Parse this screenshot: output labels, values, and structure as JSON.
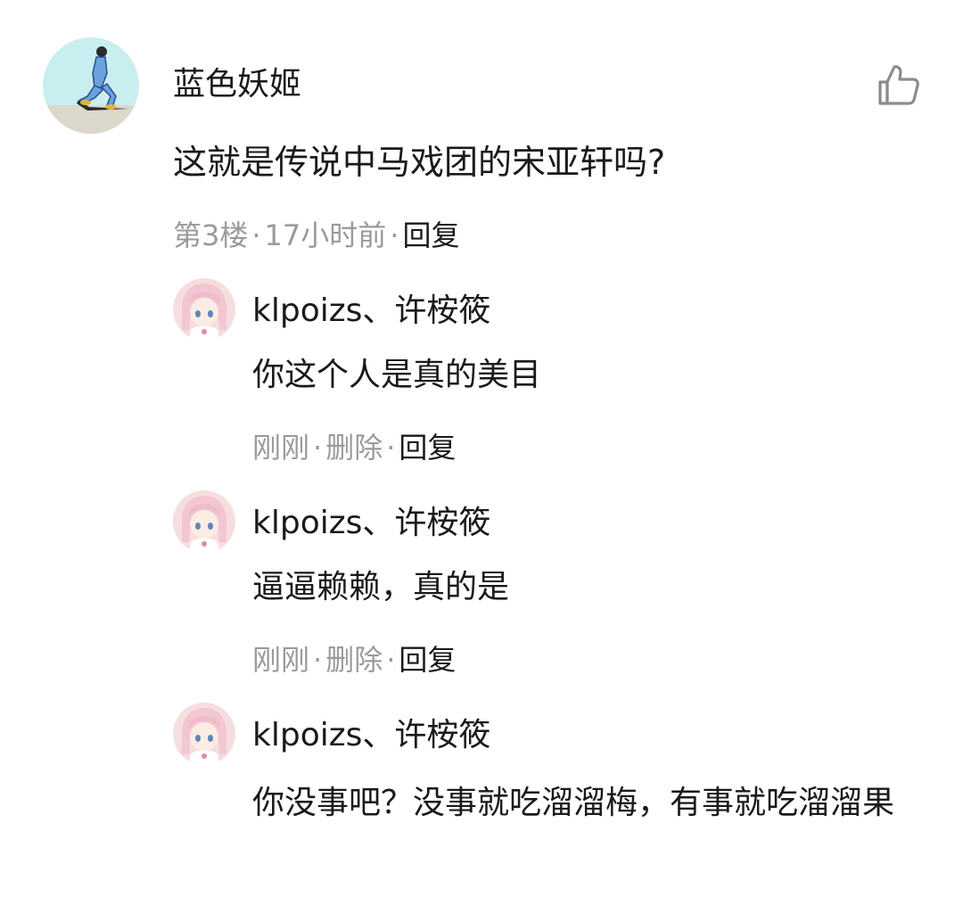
{
  "main_comment": {
    "avatar_icon": "cartoon-man-avatar-icon",
    "username": "蓝色妖姬",
    "text": "这就是传说中马戏团的宋亚轩吗?",
    "floor": "第3楼",
    "time": "17小时前",
    "reply_label": "回复",
    "like_icon": "thumbs-up-icon"
  },
  "replies": [
    {
      "avatar_icon": "anime-girl-avatar-icon",
      "username": "klpoizs、许桉筱",
      "text": "你这个人是真的美目",
      "time": "刚刚",
      "delete_label": "删除",
      "reply_label": "回复"
    },
    {
      "avatar_icon": "anime-girl-avatar-icon",
      "username": "klpoizs、许桉筱",
      "text": "逼逼赖赖，真的是",
      "time": "刚刚",
      "delete_label": "删除",
      "reply_label": "回复"
    },
    {
      "avatar_icon": "anime-girl-avatar-icon",
      "username": "klpoizs、许桉筱",
      "text": "你没事吧？没事就吃溜溜梅，有事就吃溜溜果"
    }
  ],
  "separator": "·",
  "colors": {
    "primary_text": "#1a1a1a",
    "meta_text": "#9a9a9a",
    "main_avatar_bg": "#c9eef0",
    "reply_avatar_bg": "#f6dede"
  }
}
